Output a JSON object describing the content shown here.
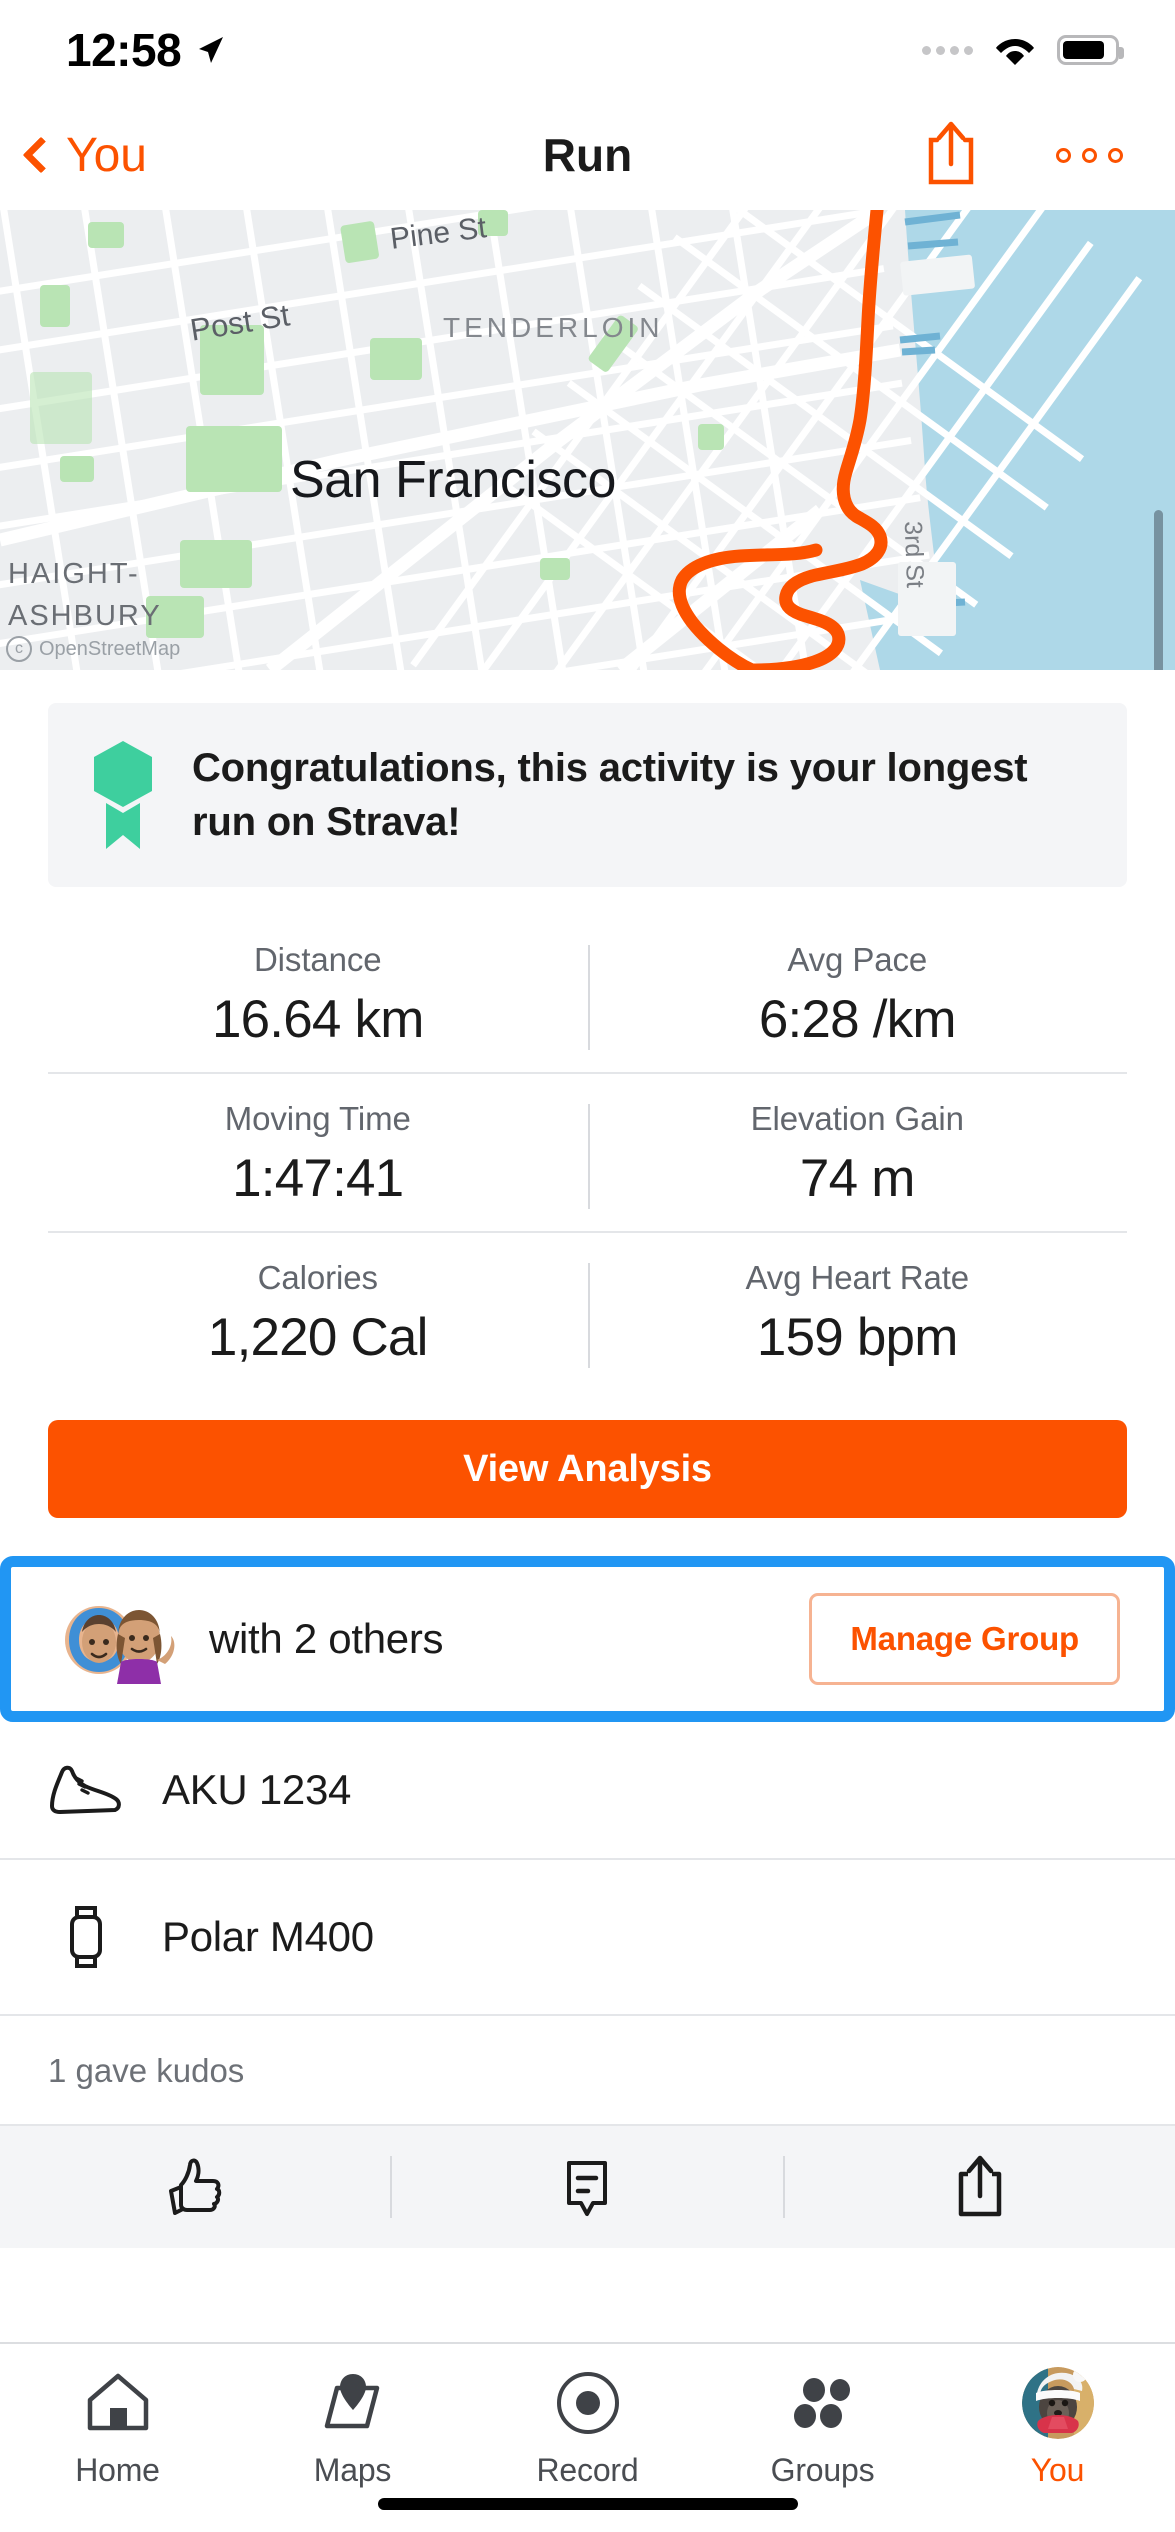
{
  "status_bar": {
    "time": "12:58",
    "location_icon": "location-arrow-icon",
    "cellular_icon": "cellular-dots-icon",
    "wifi_icon": "wifi-icon",
    "battery_icon": "battery-icon"
  },
  "nav": {
    "back_label": "You",
    "title": "Run",
    "share_icon": "share-icon",
    "more_icon": "more-options-icon"
  },
  "map": {
    "labels": {
      "pine": "Pine St",
      "post": "Post St",
      "tenderloin": "TENDERLOIN",
      "city": "San Francisco",
      "haight": "HAIGHT-",
      "ashbury": "ASHBURY",
      "third": "3rd St"
    },
    "attribution": "OpenStreetMap",
    "route_color": "#FC5200",
    "water_color": "#aed8e8",
    "land_color": "#eceef0",
    "park_color": "#b9e4b4"
  },
  "achievement": {
    "icon": "achievement-medal-icon",
    "text": "Congratulations, this activity is your longest run on Strava!",
    "badge_color": "#3ecf9e"
  },
  "stats": [
    {
      "label": "Distance",
      "value": "16.64 km"
    },
    {
      "label": "Avg Pace",
      "value": "6:28 /km"
    },
    {
      "label": "Moving Time",
      "value": "1:47:41"
    },
    {
      "label": "Elevation Gain",
      "value": "74 m"
    },
    {
      "label": "Calories",
      "value": "1,220 Cal"
    },
    {
      "label": "Avg Heart Rate",
      "value": "159 bpm"
    }
  ],
  "analysis": {
    "label": "View Analysis",
    "color": "#FC5200"
  },
  "group": {
    "text": "with 2 others",
    "manage_label": "Manage Group",
    "avatar_icons": "group-avatars-icon",
    "highlight_color": "#2196F3"
  },
  "gear": [
    {
      "icon": "shoe-icon",
      "name": "AKU 1234"
    },
    {
      "icon": "watch-icon",
      "name": "Polar M400"
    }
  ],
  "kudos": {
    "text": "1 gave kudos"
  },
  "actions": [
    {
      "icon": "thumbs-up-icon",
      "name": "kudos"
    },
    {
      "icon": "comment-icon",
      "name": "comment"
    },
    {
      "icon": "share-icon",
      "name": "share"
    }
  ],
  "tabs": [
    {
      "label": "Home",
      "icon": "home-icon",
      "active": false
    },
    {
      "label": "Maps",
      "icon": "maps-icon",
      "active": false
    },
    {
      "label": "Record",
      "icon": "record-icon",
      "active": false
    },
    {
      "label": "Groups",
      "icon": "groups-icon",
      "active": false
    },
    {
      "label": "You",
      "icon": "avatar-icon",
      "active": true
    }
  ]
}
